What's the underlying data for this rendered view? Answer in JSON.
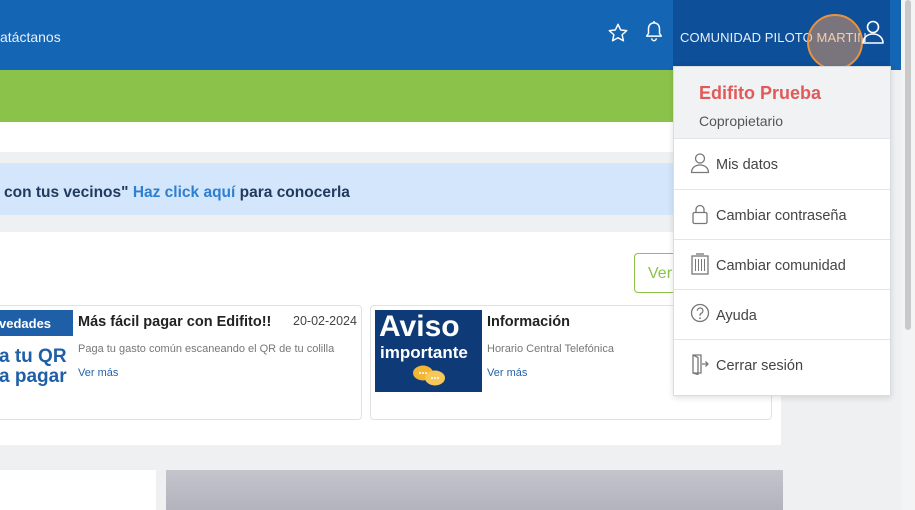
{
  "header": {
    "contact_text": "atáctanos",
    "community_label": "COMUNIDAD PILOTO MARTIN"
  },
  "banner": {
    "prefix": "con tus vecinos\"",
    "link": "Haz click aquí",
    "suffix": "para conocerla"
  },
  "panel": {
    "ver_button": "Ver"
  },
  "cards": [
    {
      "thumb_bar": "vedades",
      "thumb_line1": "a tu QR",
      "thumb_line2": "a pagar",
      "title": "Más fácil pagar con Edifito!!",
      "date": "20-02-2024",
      "description": "Paga tu gasto común escaneando el QR de tu colilla",
      "more": "Ver más"
    },
    {
      "thumb_line1": "Aviso",
      "thumb_line2": "importante",
      "title": "Información",
      "description": "Horario Central Telefónica",
      "more": "Ver más"
    }
  ],
  "dropdown": {
    "title": "Edifito Prueba",
    "role": "Copropietario",
    "items": [
      {
        "label": "Mis datos",
        "icon": "user-icon"
      },
      {
        "label": "Cambiar contraseña",
        "icon": "lock-icon"
      },
      {
        "label": "Cambiar comunidad",
        "icon": "building-icon"
      },
      {
        "label": "Ayuda",
        "icon": "help-icon"
      },
      {
        "label": "Cerrar sesión",
        "icon": "logout-icon"
      }
    ]
  },
  "colors": {
    "header_blue": "#1565b5",
    "green_bar": "#8bc34a",
    "dropdown_title": "#e05a5a",
    "link_blue": "#2d7fd0"
  }
}
